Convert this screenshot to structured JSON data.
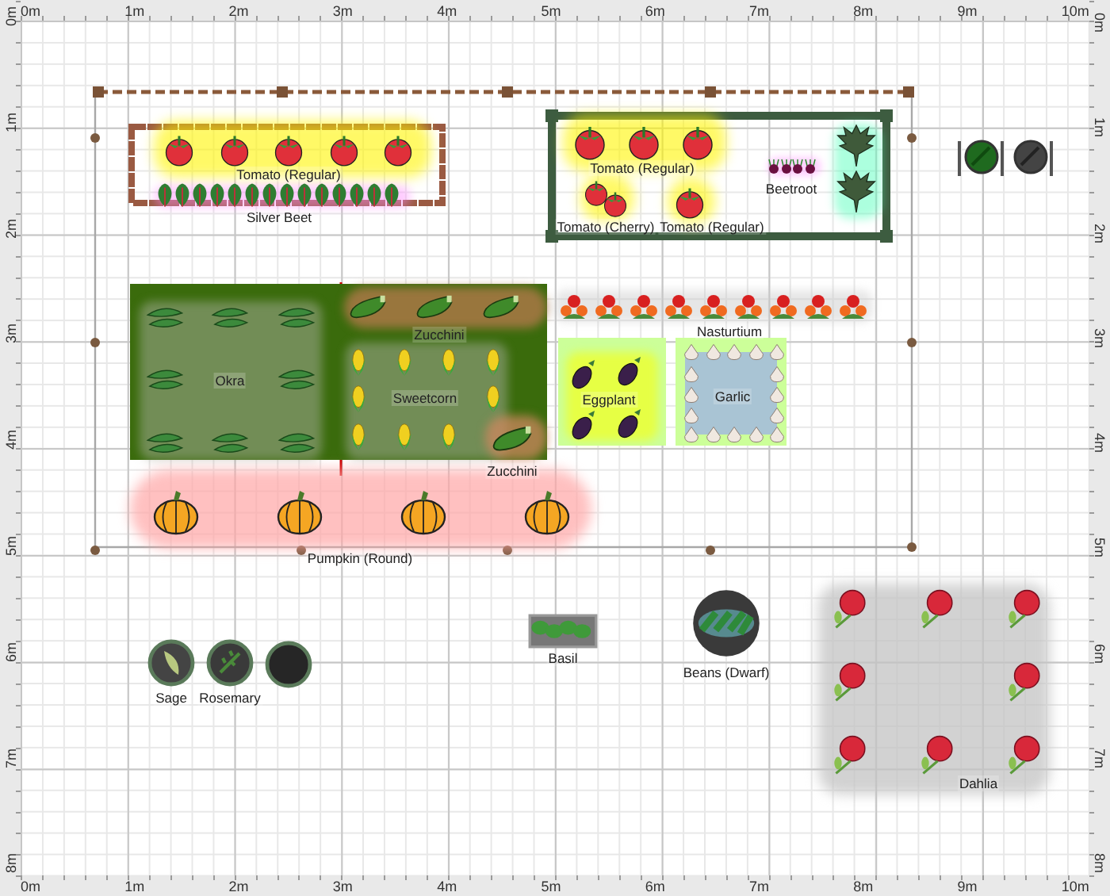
{
  "rulers": {
    "top": [
      "0m",
      "1m",
      "2m",
      "3m",
      "4m",
      "5m",
      "6m",
      "7m",
      "8m",
      "9m",
      "10m"
    ],
    "left": [
      "0m",
      "1m",
      "2m",
      "3m",
      "4m",
      "5m",
      "6m",
      "7m",
      "8m"
    ],
    "right": [
      "0m",
      "1m",
      "2m",
      "3m",
      "4m",
      "5m",
      "6m",
      "7m",
      "8m"
    ],
    "bottom": [
      "0m",
      "1m",
      "2m",
      "3m",
      "4m",
      "5m",
      "6m",
      "7m",
      "8m",
      "9m",
      "10m"
    ]
  },
  "plantings": [
    {
      "label": "Tomato (Regular)",
      "kind": "tomato"
    },
    {
      "label": "Silver Beet",
      "kind": "chard"
    },
    {
      "label": "Tomato (Regular)",
      "kind": "tomato"
    },
    {
      "label": "Beetroot",
      "kind": "beetroot"
    },
    {
      "kind": "kale"
    },
    {
      "label": "Tomato (Cherry)",
      "kind": "tomato"
    },
    {
      "label": "Tomato (Regular)",
      "kind": "tomato"
    },
    {
      "label": "Okra",
      "kind": "okra"
    },
    {
      "label": "Zucchini",
      "kind": "zucchini"
    },
    {
      "label": "Sweetcorn",
      "kind": "corn"
    },
    {
      "label": "Zucchini",
      "kind": "zucchini"
    },
    {
      "label": "Nasturtium",
      "kind": "nasturtium"
    },
    {
      "label": "Eggplant",
      "kind": "eggplant"
    },
    {
      "label": "Garlic",
      "kind": "garlic"
    },
    {
      "label": "Pumpkin (Round)",
      "kind": "pumpkin"
    },
    {
      "label": "Sage",
      "kind": "sage"
    },
    {
      "label": "Rosemary",
      "kind": "rosemary"
    },
    {
      "kind": "pot"
    },
    {
      "label": "Basil",
      "kind": "basil"
    },
    {
      "label": "Beans (Dwarf)",
      "kind": "beans"
    },
    {
      "label": "Dahlia",
      "kind": "dahlia"
    }
  ]
}
